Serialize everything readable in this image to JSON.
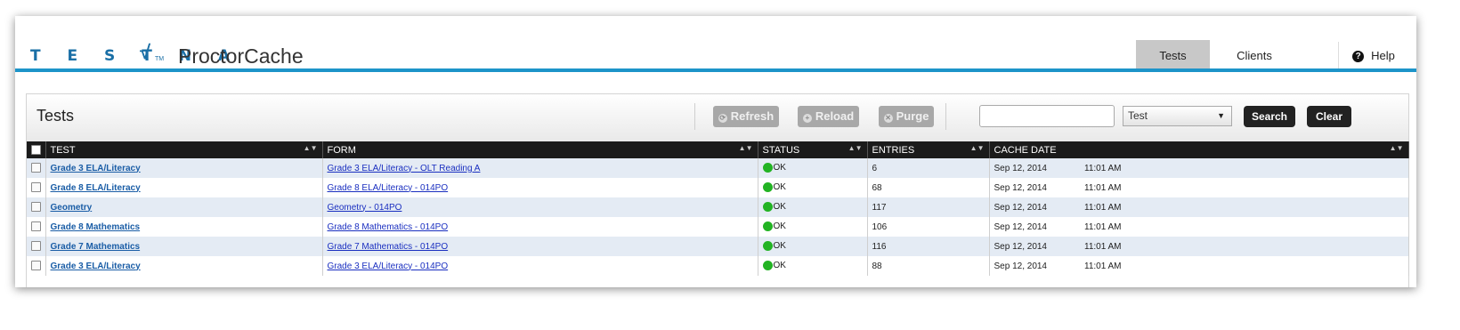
{
  "brand": {
    "wordmark": "TESTNAV",
    "wordmark_visible": "T E S T N A",
    "check_glyph": "√",
    "trademark": "TM",
    "product": "ProctorCache"
  },
  "nav": {
    "tabs": [
      {
        "label": "Tests",
        "active": true
      },
      {
        "label": "Clients",
        "active": false
      }
    ],
    "help_label": "Help",
    "help_icon": "?"
  },
  "panel": {
    "title": "Tests"
  },
  "toolbar": {
    "refresh_label": "Refresh",
    "reload_label": "Reload",
    "purge_label": "Purge",
    "search_value": "",
    "select_value": "Test",
    "search_label": "Search",
    "clear_label": "Clear"
  },
  "table": {
    "columns": [
      "TEST",
      "FORM",
      "STATUS",
      "ENTRIES",
      "CACHE DATE"
    ],
    "rows": [
      {
        "test": "Grade 3 ELA/Literacy",
        "form": "Grade 3 ELA/Literacy - OLT Reading A",
        "status": "OK",
        "entries": "6",
        "date": "Sep 12, 2014",
        "time": "11:01 AM"
      },
      {
        "test": "Grade 8 ELA/Literacy",
        "form": "Grade 8 ELA/Literacy - 014PO",
        "status": "OK",
        "entries": "68",
        "date": "Sep 12, 2014",
        "time": "11:01 AM"
      },
      {
        "test": "Geometry",
        "form": "Geometry - 014PO",
        "status": "OK",
        "entries": "117",
        "date": "Sep 12, 2014",
        "time": "11:01 AM"
      },
      {
        "test": "Grade 8 Mathematics",
        "form": "Grade 8 Mathematics - 014PO",
        "status": "OK",
        "entries": "106",
        "date": "Sep 12, 2014",
        "time": "11:01 AM"
      },
      {
        "test": "Grade 7 Mathematics",
        "form": "Grade 7 Mathematics - 014PO",
        "status": "OK",
        "entries": "116",
        "date": "Sep 12, 2014",
        "time": "11:01 AM"
      },
      {
        "test": "Grade 3 ELA/Literacy",
        "form": "Grade 3 ELA/Literacy - 014PO",
        "status": "OK",
        "entries": "88",
        "date": "Sep 12, 2014",
        "time": "11:01 AM"
      }
    ]
  },
  "colors": {
    "accent": "#1d94c9",
    "brand": "#1a6fa6",
    "status_ok": "#22b323",
    "header_bg": "#1b1b1b",
    "row_alt": "#e4ebf4"
  }
}
